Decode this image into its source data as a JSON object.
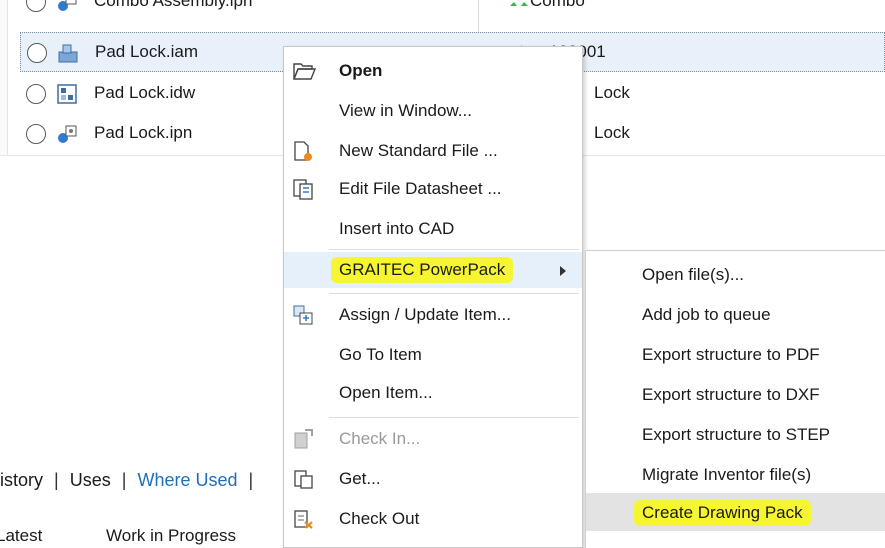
{
  "file_list": {
    "rows": [
      {
        "name": "Combo Assembly.ipn",
        "col2": "Combo",
        "selected": false
      },
      {
        "name": "Pad Lock.iam",
        "col2": "100001",
        "selected": true
      },
      {
        "name": "Pad Lock.idw",
        "col2": "Lock",
        "selected": false
      },
      {
        "name": "Pad Lock.ipn",
        "col2": "Lock",
        "selected": false
      }
    ]
  },
  "tabs": {
    "history": "istory",
    "uses": "Uses",
    "where_used": "Where Used",
    "sep": "|"
  },
  "subheader": {
    "col1": "Latest",
    "col2": "Work in Progress"
  },
  "context_menu": {
    "items": [
      {
        "label": "Open",
        "icon": "folder-open-icon"
      },
      {
        "label": "View in Window..."
      },
      {
        "label": "New Standard File ...",
        "icon": "new-file-icon"
      },
      {
        "label": "Edit File Datasheet ...",
        "icon": "datasheet-icon"
      },
      {
        "label": "Insert into CAD"
      },
      {
        "label": "GRAITEC PowerPack"
      },
      {
        "label": "Assign / Update Item...",
        "icon": "assign-item-icon"
      },
      {
        "label": "Go To Item"
      },
      {
        "label": "Open Item..."
      },
      {
        "label": "Check In...",
        "icon": "check-in-icon"
      },
      {
        "label": "Get...",
        "icon": "get-icon"
      },
      {
        "label": "Check Out",
        "icon": "check-out-icon"
      }
    ]
  },
  "sub_menu": {
    "items": [
      {
        "label": "Open file(s)..."
      },
      {
        "label": "Add job to queue"
      },
      {
        "label": "Export structure to PDF"
      },
      {
        "label": "Export structure to DXF"
      },
      {
        "label": "Export structure to STEP"
      },
      {
        "label": "Migrate Inventor file(s)"
      },
      {
        "label": "Create Drawing Pack"
      }
    ]
  },
  "colors": {
    "highlight_yellow": "#f6f532",
    "link_blue": "#1f6fb8",
    "selection_blue": "#e8f1fa"
  }
}
